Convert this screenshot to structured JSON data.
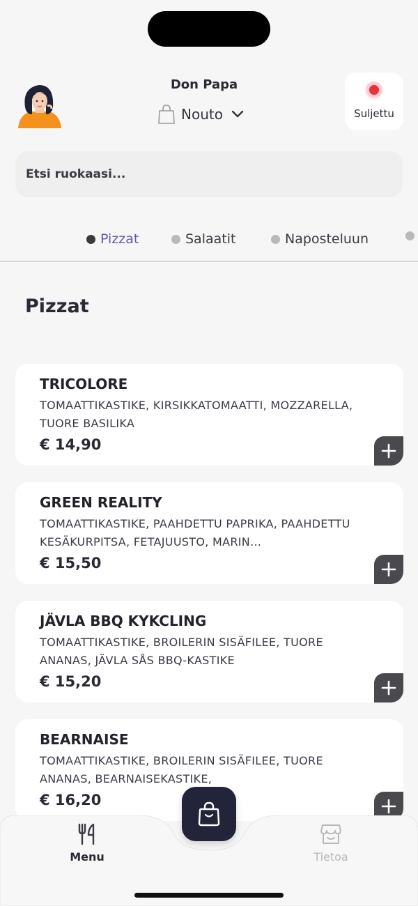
{
  "header": {
    "restaurant_name": "Don Papa",
    "order_mode": "Nouto",
    "status_label": "Suljettu",
    "status_color": "#e8323a"
  },
  "search": {
    "placeholder": "Etsi ruokaasi..."
  },
  "categories": [
    {
      "label": "Pizzat",
      "active": true
    },
    {
      "label": "Salaatit",
      "active": false
    },
    {
      "label": "Naposteluun",
      "active": false
    }
  ],
  "section": {
    "title": "Pizzat"
  },
  "items": [
    {
      "name": "TRICOLORE",
      "description": "TOMAATTIKASTIKE, KIRSIKKATOMAATTI, MOZZARELLA, TUORE BASILIKA",
      "price": "€ 14,90"
    },
    {
      "name": "GREEN REALITY",
      "description": "TOMAATTIKASTIKE, PAAHDETTU PAPRIKA, PAAHDETTU KESÄKURPITSA, FETAJUUSTO, MARIN...",
      "price": "€ 15,50"
    },
    {
      "name": "JÄVLA BBQ KYKCLING",
      "description": "TOMAATTIKASTIKE, BROILERIN SISÄFILEE, TUORE ANANAS, JÄVLA SÅS BBQ-KASTIKE",
      "price": "€ 15,20"
    },
    {
      "name": "BEARNAISE",
      "description": "TOMAATTIKASTIKE, BROILERIN SISÄFILEE, TUORE ANANAS, BEARNAISEKASTIKE,",
      "price": "€ 16,20"
    }
  ],
  "bottom_nav": {
    "menu_label": "Menu",
    "info_label": "Tietoa"
  },
  "icons": {
    "avatar": "avatar",
    "bag": "shopping-bag-icon",
    "chevron": "chevron-down-icon",
    "add": "plus-icon",
    "menu": "fork-knife-icon",
    "info": "store-icon"
  },
  "colors": {
    "accent": "#6b55a8",
    "cart_button": "#23233a",
    "add_button": "#4a4a4e"
  }
}
